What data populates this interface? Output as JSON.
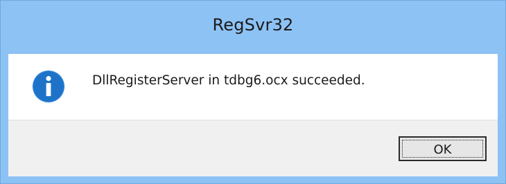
{
  "window": {
    "title": "RegSvr32"
  },
  "dialog": {
    "icon": "info-icon",
    "message": "DllRegisterServer in tdbg6.ocx succeeded.",
    "ok_label": "OK"
  },
  "colors": {
    "titlebar": "#8dc2f5",
    "icon_blue": "#1e73c9",
    "content_bg": "#ffffff",
    "footer_bg": "#f0f0f0"
  }
}
